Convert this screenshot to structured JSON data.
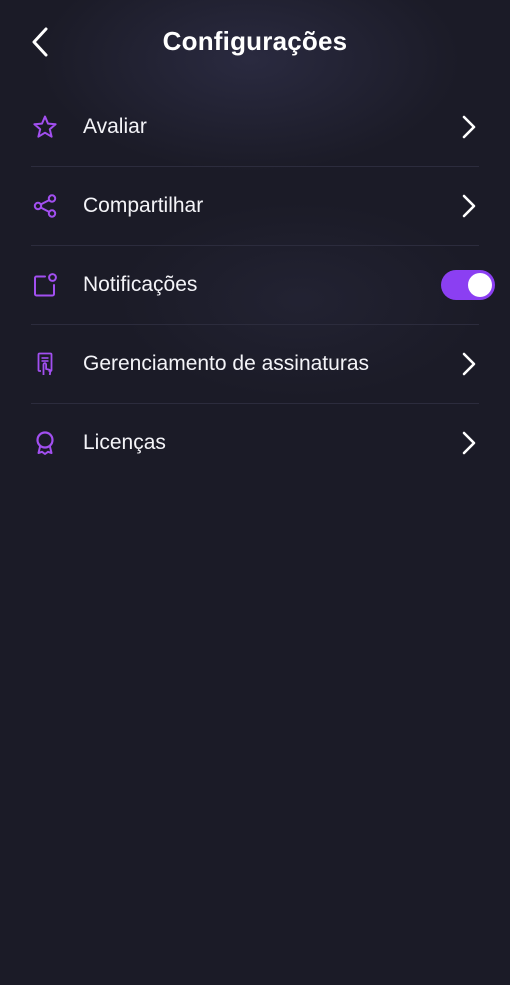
{
  "header": {
    "title": "Configurações",
    "back_icon": "chevron-left-icon"
  },
  "colors": {
    "background": "#1b1b27",
    "accent": "#a24ff0",
    "toggle_on": "#8b3ff2",
    "divider": "#2c2c3d"
  },
  "settings": {
    "items": [
      {
        "label": "Avaliar",
        "icon": "star-icon",
        "control": "chevron"
      },
      {
        "label": "Compartilhar",
        "icon": "share-icon",
        "control": "chevron"
      },
      {
        "label": "Notificações",
        "icon": "notification-icon",
        "control": "toggle",
        "toggle_on": true
      },
      {
        "label": "Gerenciamento de assinaturas",
        "icon": "subscription-icon",
        "control": "chevron"
      },
      {
        "label": "Licenças",
        "icon": "license-icon",
        "control": "chevron"
      }
    ]
  }
}
